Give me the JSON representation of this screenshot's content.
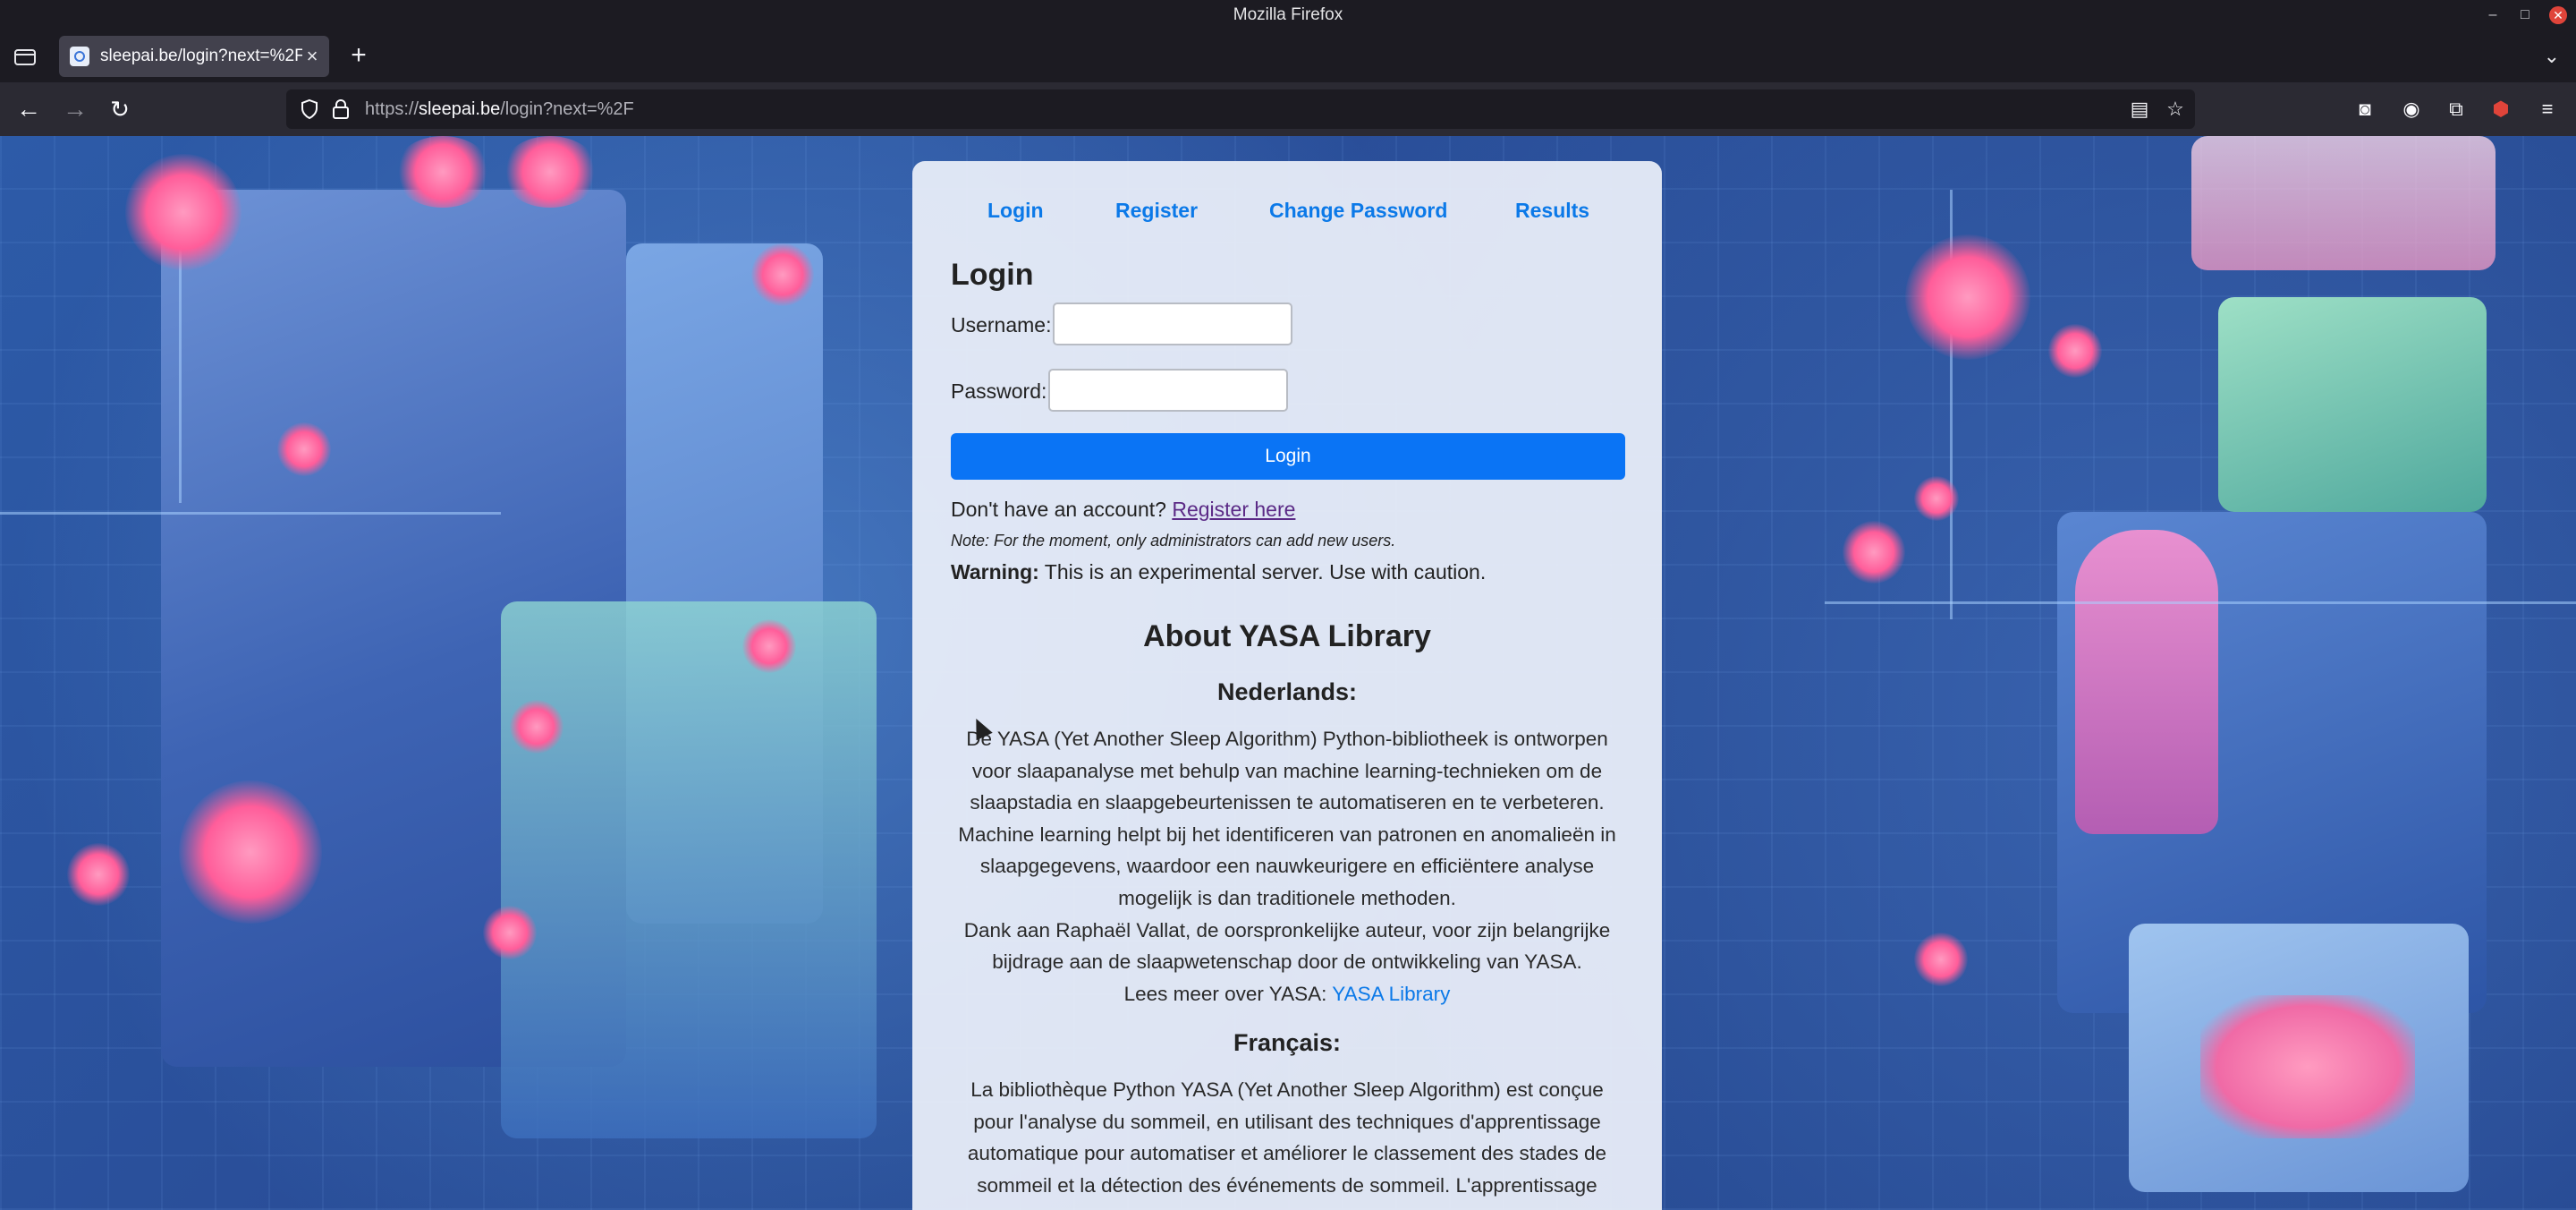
{
  "window": {
    "title": "Mozilla Firefox"
  },
  "browser": {
    "tab": {
      "title": "sleepai.be/login?next=%2F"
    },
    "url": {
      "scheme": "https://",
      "host": "sleepai.be",
      "path": "/login?next=%2F"
    }
  },
  "nav": {
    "links": [
      "Login",
      "Register",
      "Change Password",
      "Results"
    ]
  },
  "login": {
    "title": "Login",
    "username_label": "Username:",
    "password_label": "Password:",
    "username_value": "",
    "password_value": "",
    "submit_label": "Login",
    "no_account_text": "Don't have an account?",
    "register_link": "Register here",
    "note": "Note: For the moment, only administrators can add new users.",
    "warning_label": "Warning:",
    "warning_text": "This is an experimental server. Use with caution."
  },
  "about": {
    "title": "About YASA Library",
    "nl": {
      "heading": "Nederlands:",
      "text": "De YASA (Yet Another Sleep Algorithm) Python-bibliotheek is ontworpen voor slaapanalyse met behulp van machine learning-technieken om de slaapstadia en slaapgebeurtenissen te automatiseren en te verbeteren. Machine learning helpt bij het identificeren van patronen en anomalieën in slaapgegevens, waardoor een nauwkeurigere en efficiëntere analyse mogelijk is dan traditionele methoden.",
      "thanks": "Dank aan Raphaël Vallat, de oorspronkelijke auteur, voor zijn belangrijke bijdrage aan de slaapwetenschap door de ontwikkeling van YASA.",
      "more_text": "Lees meer over YASA:",
      "more_link": "YASA Library"
    },
    "fr": {
      "heading": "Français:",
      "text": "La bibliothèque Python YASA (Yet Another Sleep Algorithm) est conçue pour l'analyse du sommeil, en utilisant des techniques d'apprentissage automatique pour automatiser et améliorer le classement des stades de sommeil et la détection des événements de sommeil. L'apprentissage"
    }
  },
  "colors": {
    "link": "#0b79e8",
    "button": "#0a74f5",
    "card_bg": "#ecf0fa"
  }
}
